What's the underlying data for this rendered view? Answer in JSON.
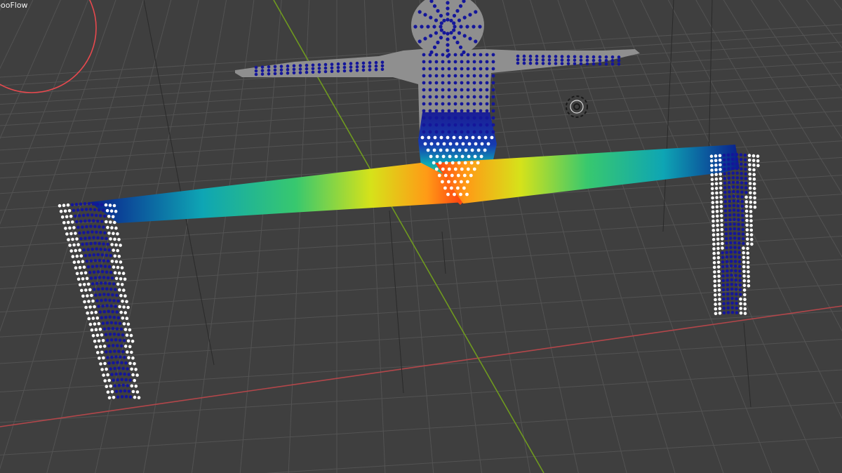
{
  "viewport": {
    "object_label": "booFlow",
    "background": "#3f3f3f",
    "grid_color": "#535353",
    "x_axis_color": "#b3464a",
    "y_axis_color": "#6f9a1f",
    "selection_circle_color": "#e8494e",
    "body_color": "#8f8f8f",
    "point_colors": [
      "#14169a",
      "#ffffff"
    ],
    "strip_gradient": [
      "#0a1e8c",
      "#0ea5b4",
      "#38c86e",
      "#d6e21a",
      "#ff9a16",
      "#ff3b10"
    ]
  },
  "cursor": {
    "icon": "3d-cursor-icon"
  },
  "ui_elements": [
    {
      "name": "object-name-label",
      "icon": ""
    },
    {
      "name": "3d-cursor-icon",
      "icon": "3d-cursor-icon"
    },
    {
      "name": "brush-radius-circle",
      "icon": "circle"
    }
  ]
}
